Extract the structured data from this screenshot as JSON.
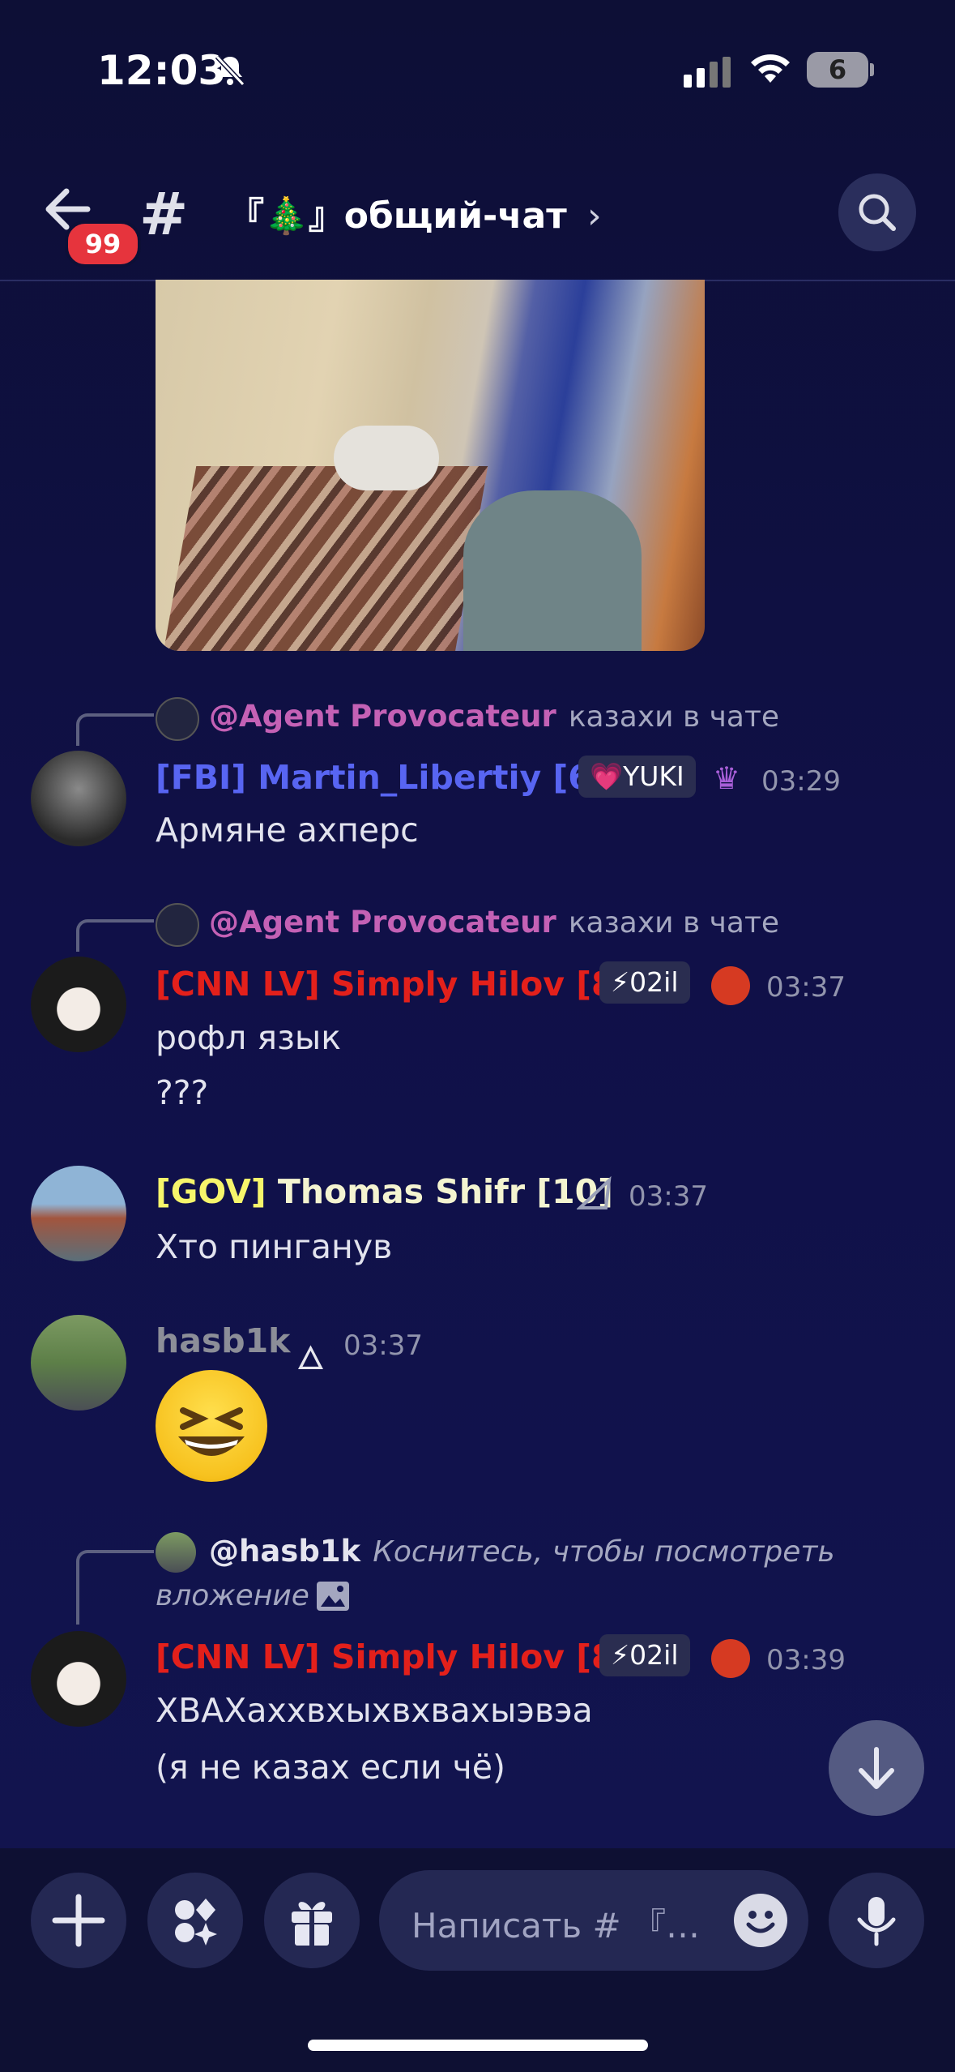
{
  "status_bar": {
    "time": "12:03",
    "battery": "6"
  },
  "header": {
    "back_badge": "99",
    "channel_hash": "#",
    "channel_name": "『🎄』общий-чат",
    "chevron": "›"
  },
  "messages": [
    {
      "reply": {
        "author": "@Agent Provocateur",
        "text": "казахи в чате"
      },
      "author": "[FBI] Martin_Libertiy [6]",
      "author_color": "#5865f2",
      "tag": "💗YUKI",
      "time": "03:29",
      "lines": [
        "Армяне ахперс"
      ]
    },
    {
      "reply": {
        "author": "@Agent Provocateur",
        "text": "казахи в чате"
      },
      "author": "[CNN LV] Simply Hilov [8]",
      "author_color": "#e3201b",
      "tag": "⚡02il",
      "time": "03:37",
      "lines": [
        "рофл язык",
        "???"
      ]
    },
    {
      "author_prefix": "[GOV]",
      "author_rest": " Thomas Shifr [10]",
      "author_color": "#f6f56b",
      "time": "03:37",
      "lines": [
        "Хто пинганув"
      ]
    },
    {
      "author": "hasb1k",
      "author_color": "#8c8e98",
      "time": "03:37",
      "lines": []
    },
    {
      "reply": {
        "author": "@hasb1k",
        "text": "Коснитесь, чтобы посмотреть",
        "text2": "вложение"
      },
      "author": "[CNN LV] Simply Hilov [8]",
      "author_color": "#e3201b",
      "tag": "⚡02il",
      "time": "03:39",
      "lines": [
        "ХВАХаххвхыхвхвахыэвэа",
        "(я не казах если чё)"
      ]
    }
  ],
  "composer": {
    "placeholder": "Написать # 『…"
  },
  "colors": {
    "accent": "#5865f2",
    "mention": "#c461b5",
    "badge": "#e6343d"
  }
}
